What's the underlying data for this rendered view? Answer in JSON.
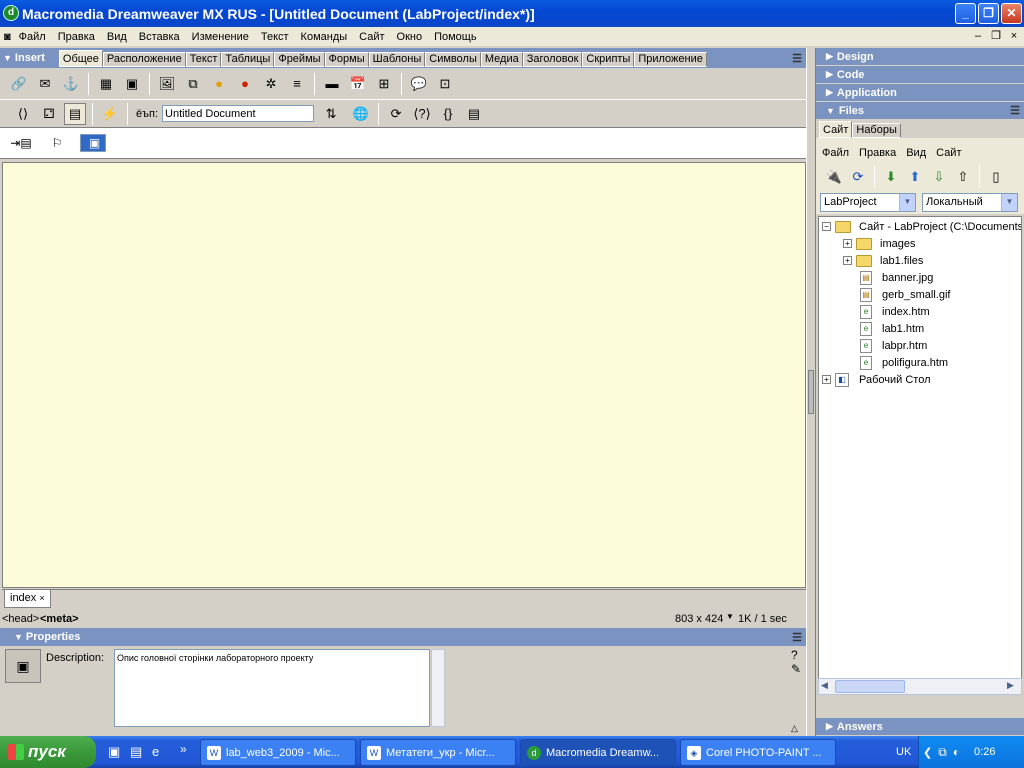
{
  "window": {
    "title": "Macromedia Dreamweaver MX RUS - [Untitled Document (LabProject/index*)]",
    "minimize": "_",
    "maximize": "❐",
    "close": "✕"
  },
  "menubar": {
    "items": [
      "Файл",
      "Правка",
      "Вид",
      "Вставка",
      "Изменение",
      "Текст",
      "Команды",
      "Сайт",
      "Окно",
      "Помощь"
    ]
  },
  "insert_panel": {
    "title": "Insert",
    "tabs": [
      "Общее",
      "Расположение",
      "Текст",
      "Таблицы",
      "Фреймы",
      "Формы",
      "Шаблоны",
      "Символы",
      "Медиа",
      "Заголовок",
      "Скрипты",
      "Приложение"
    ],
    "active_tab": "Общее"
  },
  "document_toolbar": {
    "title_label": "ёъп:",
    "title_value": "Untitled Document"
  },
  "document": {
    "tab_label": "index",
    "tab_close": "×",
    "tag_selector_head": "<head>",
    "tag_selector_meta": "<meta>",
    "window_size": "803 x 424",
    "download_stats": "1K / 1 sec"
  },
  "properties_panel": {
    "title": "Properties",
    "description_label": "Description:",
    "description_value": "Опис головної сторінки лабораторного проекту"
  },
  "right_panels": {
    "design": "Design",
    "code": "Code",
    "application": "Application",
    "files": "Files",
    "answers": "Answers"
  },
  "files_panel": {
    "tabs": [
      "Сайт",
      "Наборы"
    ],
    "active_tab": "Сайт",
    "menu": [
      "Файл",
      "Правка",
      "Вид",
      "Сайт"
    ],
    "site_select": "LabProject",
    "view_select": "Локальный",
    "tree": {
      "root": "Сайт - LabProject (C:\\Documents",
      "items": [
        "images",
        "lab1.files",
        "banner.jpg",
        "gerb_small.gif",
        "index.htm",
        "lab1.htm",
        "labpr.htm",
        "polifigura.htm"
      ],
      "desktop": "Рабочий Стол"
    }
  },
  "taskbar": {
    "start_label": "пуск",
    "tasks": [
      "lab_web3_2009 - Mic...",
      "Метатеги_укр - Micr...",
      "Macromedia Dreamw...",
      "Corel PHOTO-PAINT ..."
    ],
    "active_task": "Macromedia Dreamw...",
    "language": "UK",
    "clock": "0:26"
  },
  "colors": {
    "titlebar": "#0548d3",
    "panel_header": "#7a93c0",
    "canvas": "#fcfcd9",
    "taskbar": "#245edb",
    "start_button": "#3a9a3a"
  }
}
